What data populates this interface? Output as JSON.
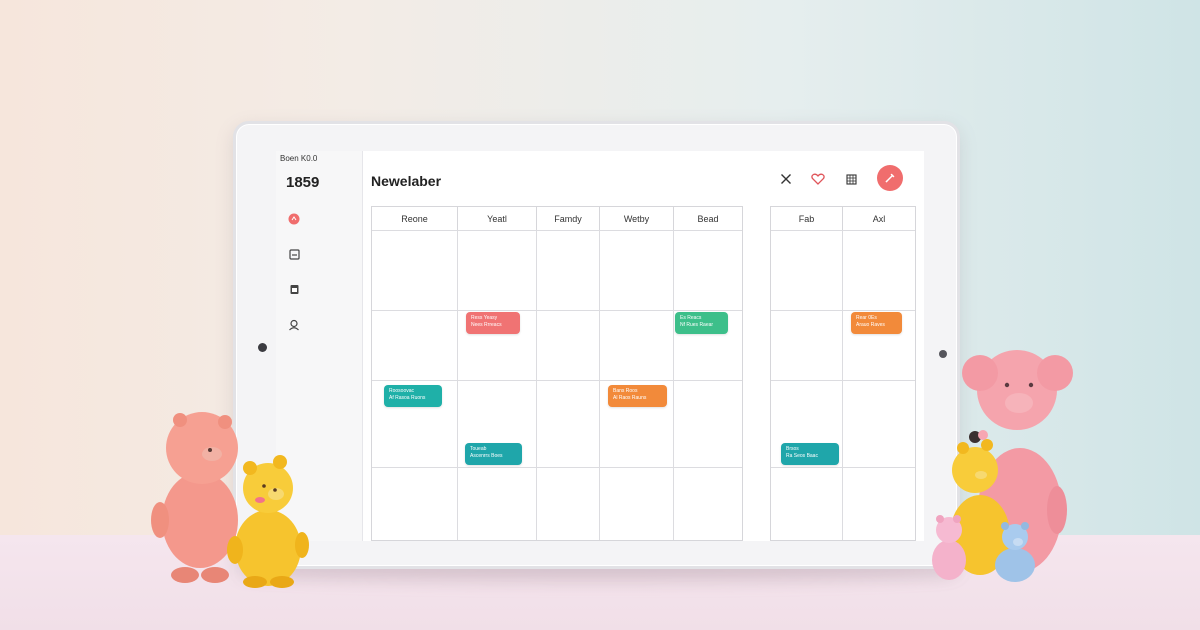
{
  "device": {
    "status_text": "Boen K0.0",
    "sidebar_number": "1859"
  },
  "header": {
    "title": "Newelaber",
    "icons": [
      "close-icon",
      "heart-icon",
      "grid-icon",
      "edit-icon"
    ]
  },
  "sidebar": {
    "icons": [
      "alert-icon",
      "inbox-icon",
      "calendar-icon",
      "profile-icon"
    ]
  },
  "calendar": {
    "columns_a": [
      "Reone",
      "Yeatl",
      "Famdy",
      "Wetby",
      "Bead"
    ],
    "columns_b": [
      "Fab",
      "Axl"
    ],
    "events": [
      {
        "id": "e1",
        "line1": "Ress Yeasy",
        "line2": "Nees Rrreacs",
        "color": "#f07373"
      },
      {
        "id": "e2",
        "line1": "Es Reacs",
        "line2": "Nf Rues Raear",
        "color": "#3dbf8a"
      },
      {
        "id": "e3",
        "line1": "Rear 0Es",
        "line2": "Arauo Raves",
        "color": "#f28a3a"
      },
      {
        "id": "e4",
        "line1": "Roosoovac",
        "line2": "Af Rasoa Ruons",
        "color": "#1fb0a8"
      },
      {
        "id": "e5",
        "line1": "Bans Roos",
        "line2": "Al Raos Rauns",
        "color": "#f28a3a"
      },
      {
        "id": "e6",
        "line1": "Toueab",
        "line2": "Ascenrrs Boes",
        "color": "#1fa6aa"
      },
      {
        "id": "e7",
        "line1": "Brsos",
        "line2": "Ra Seos Baac",
        "color": "#1fa6aa"
      }
    ]
  },
  "colors": {
    "accent": "#f06d6d",
    "grid_line": "#dcdce0"
  }
}
